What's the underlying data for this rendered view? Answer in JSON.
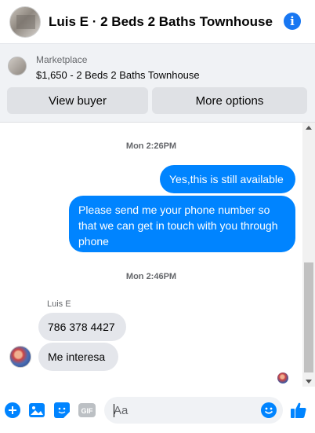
{
  "header": {
    "title": "Luis E · 2 Beds 2 Baths Townhouse",
    "info_icon": "info-icon"
  },
  "marketplace": {
    "label": "Marketplace",
    "listing": "$1,650 - 2 Beds 2 Baths Townhouse",
    "view_buyer": "View buyer",
    "more_options": "More options"
  },
  "conversation": {
    "timestamp1": "Mon 2:26PM",
    "timestamp2": "Mon 2:46PM",
    "sender_name": "Luis E",
    "messages": [
      {
        "direction": "outgoing",
        "text": "Yes,this is still available"
      },
      {
        "direction": "outgoing",
        "text": "Please send me your phone  number so that we can get in touch with you through phone"
      },
      {
        "direction": "incoming",
        "text": "786 378 4427"
      },
      {
        "direction": "incoming",
        "text": "Me interesa"
      }
    ]
  },
  "composer": {
    "placeholder": "Aa",
    "gif_label": "GIF",
    "icons": [
      "plus-icon",
      "image-icon",
      "sticker-icon",
      "gif-icon",
      "emoji-icon",
      "like-icon"
    ]
  },
  "colors": {
    "accent": "#0084ff",
    "brand": "#1877f2",
    "incoming_bubble": "#e4e6eb",
    "panel_bg": "#f0f2f5"
  }
}
